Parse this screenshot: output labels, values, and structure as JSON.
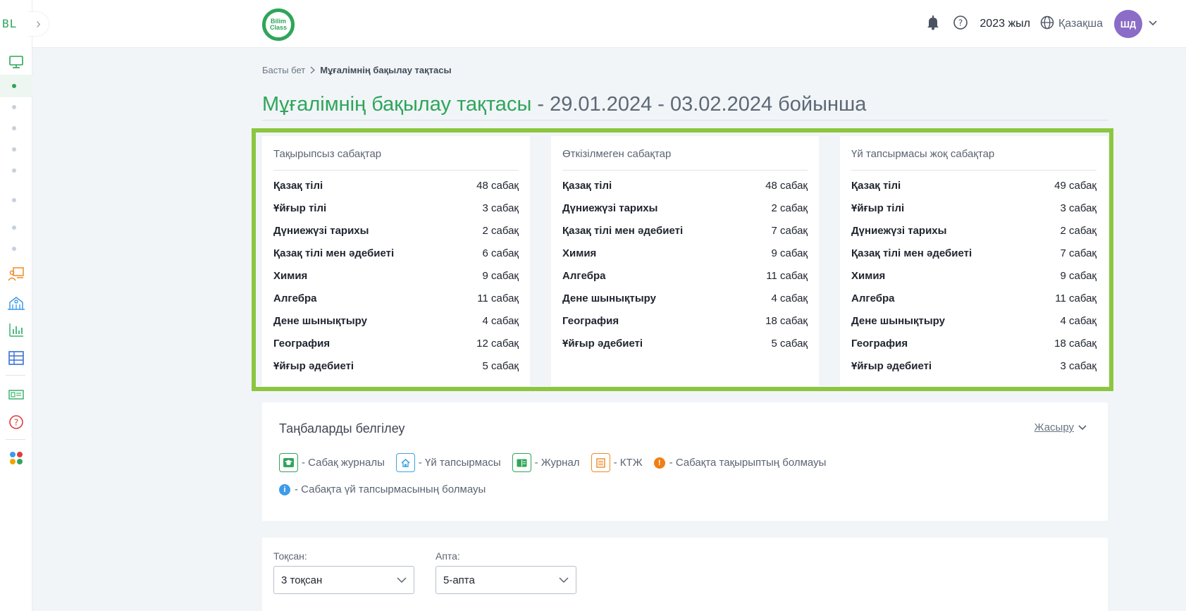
{
  "sidebar": {
    "logo": "BL",
    "toggle": "›"
  },
  "header": {
    "logo_text_1": "Bilim",
    "logo_text_2": "Class",
    "year": "2023 жыл",
    "language": "Қазақша",
    "avatar": "ШД"
  },
  "breadcrumb": {
    "home": "Басты бет",
    "current": "Мұғалімнің бақылау тақтасы"
  },
  "page": {
    "title": "Мұғалімнің бақылау тақтасы",
    "title_rest": " - 29.01.2024 - 03.02.2024 бойынша"
  },
  "cards": [
    {
      "title": "Тақырыпсыз сабақтар",
      "rows": [
        {
          "subject": "Қазақ тілі",
          "count": "48 сабақ"
        },
        {
          "subject": "Ұйғыр тілі",
          "count": "3 сабақ"
        },
        {
          "subject": "Дүниежүзі тарихы",
          "count": "2 сабақ"
        },
        {
          "subject": "Қазақ тілі мен әдебиеті",
          "count": "6 сабақ"
        },
        {
          "subject": "Химия",
          "count": "9 сабақ"
        },
        {
          "subject": "Алгебра",
          "count": "11 сабақ"
        },
        {
          "subject": "Дене шынықтыру",
          "count": "4 сабақ"
        },
        {
          "subject": "География",
          "count": "12 сабақ"
        },
        {
          "subject": "Ұйғыр әдебиеті",
          "count": "5 сабақ"
        }
      ]
    },
    {
      "title": "Өткізілмеген сабақтар",
      "rows": [
        {
          "subject": "Қазақ тілі",
          "count": "48 сабақ"
        },
        {
          "subject": "Дүниежүзі тарихы",
          "count": "2 сабақ"
        },
        {
          "subject": "Қазақ тілі мен әдебиеті",
          "count": "7 сабақ"
        },
        {
          "subject": "Химия",
          "count": "9 сабақ"
        },
        {
          "subject": "Алгебра",
          "count": "11 сабақ"
        },
        {
          "subject": "Дене шынықтыру",
          "count": "4 сабақ"
        },
        {
          "subject": "География",
          "count": "18 сабақ"
        },
        {
          "subject": "Ұйғыр әдебиеті",
          "count": "5 сабақ"
        }
      ]
    },
    {
      "title": "Үй тапсырмасы жоқ сабақтар",
      "rows": [
        {
          "subject": "Қазақ тілі",
          "count": "49 сабақ"
        },
        {
          "subject": "Ұйғыр тілі",
          "count": "3 сабақ"
        },
        {
          "subject": "Дүниежүзі тарихы",
          "count": "2 сабақ"
        },
        {
          "subject": "Қазақ тілі мен әдебиеті",
          "count": "7 сабақ"
        },
        {
          "subject": "Химия",
          "count": "9 сабақ"
        },
        {
          "subject": "Алгебра",
          "count": "11 сабақ"
        },
        {
          "subject": "Дене шынықтыру",
          "count": "4 сабақ"
        },
        {
          "subject": "География",
          "count": "18 сабақ"
        },
        {
          "subject": "Ұйғыр әдебиеті",
          "count": "3 сабақ"
        }
      ]
    }
  ],
  "legend": {
    "title": "Таңбаларды белгілеу",
    "hide": "Жасыру",
    "items": [
      {
        "label": "- Сабақ журналы",
        "icon": "graduation-cap-icon",
        "color": "#2fa55a"
      },
      {
        "label": "- Үй тапсырмасы",
        "icon": "house-icon",
        "color": "#3fa3e0"
      },
      {
        "label": "- Журнал",
        "icon": "book-icon",
        "color": "#2fa55a"
      },
      {
        "label": "- КТЖ",
        "icon": "table-doc-icon",
        "color": "#f08a24"
      },
      {
        "label": "- Сабақта тақырыптың болмауы",
        "icon": "info-orange-icon",
        "color": "#f07f13"
      },
      {
        "label": "- Сабақта үй тапсырмасының болмауы",
        "icon": "info-blue-icon",
        "color": "#3d9be9"
      }
    ]
  },
  "filters": {
    "quarter_label": "Тоқсан:",
    "quarter_value": "3 тоқсан",
    "week_label": "Апта:",
    "week_value": "5-апта"
  }
}
